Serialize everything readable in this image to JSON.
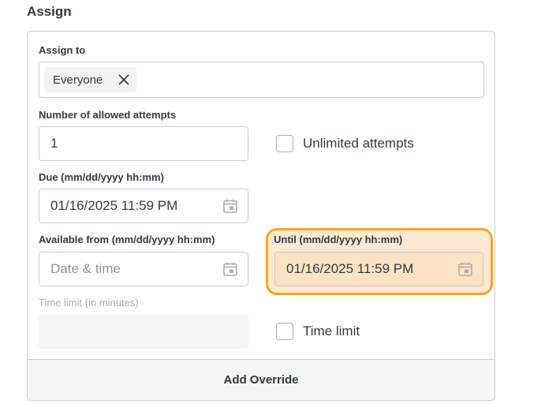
{
  "section": {
    "title": "Assign"
  },
  "assign_to": {
    "label": "Assign to",
    "tag": "Everyone"
  },
  "attempts": {
    "label": "Number of allowed attempts",
    "value": "1",
    "unlimited_label": "Unlimited attempts"
  },
  "due": {
    "label": "Due (mm/dd/yyyy hh:mm)",
    "value": "01/16/2025 11:59 PM"
  },
  "available_from": {
    "label": "Available from (mm/dd/yyyy hh:mm)",
    "placeholder": "Date & time"
  },
  "until": {
    "label": "Until (mm/dd/yyyy hh:mm)",
    "value": "01/16/2025 11:59 PM"
  },
  "time_limit": {
    "label": "Time limit (in minutes)",
    "checkbox_label": "Time limit"
  },
  "footer": {
    "add_override": "Add Override"
  },
  "colors": {
    "highlight_border": "#f5a623",
    "highlight_fill": "#fde9d2",
    "text": "#2d3b45"
  },
  "icons": {
    "tag_remove": "close-icon",
    "date_picker": "calendar-icon"
  }
}
